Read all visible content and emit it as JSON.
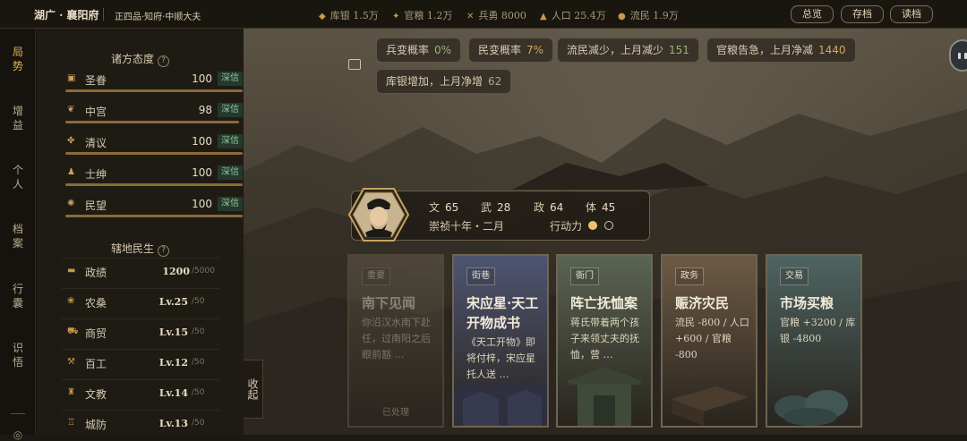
{
  "header": {
    "location": "湖广 · 襄阳府",
    "rank": "正四品·知府·中顺大夫",
    "resources": [
      {
        "icon": "silver-icon",
        "label": "库银",
        "value": "1.5万"
      },
      {
        "icon": "grain-icon",
        "label": "官粮",
        "value": "1.2万"
      },
      {
        "icon": "soldier-icon",
        "label": "兵勇",
        "value": "8000"
      },
      {
        "icon": "population-icon",
        "label": "人口",
        "value": "25.4万"
      },
      {
        "icon": "refugee-icon",
        "label": "流民",
        "value": "1.9万"
      }
    ],
    "buttons": {
      "overview": "总览",
      "save": "存档",
      "load": "读档"
    }
  },
  "nav": {
    "items": [
      "局势",
      "增益",
      "个人",
      "档案",
      "行囊",
      "识悟"
    ],
    "active": "局势"
  },
  "factions": {
    "title": "诸方态度",
    "help": "?",
    "rows": [
      {
        "icon": "emperor-icon",
        "name": "圣眷",
        "value": "100",
        "badge": "深信"
      },
      {
        "icon": "palace-icon",
        "name": "中宫",
        "value": "98",
        "badge": "深信"
      },
      {
        "icon": "scholar-icon",
        "name": "清议",
        "value": "100",
        "badge": "深信"
      },
      {
        "icon": "gentry-icon",
        "name": "士绅",
        "value": "100",
        "badge": "深信"
      },
      {
        "icon": "people-icon",
        "name": "民望",
        "value": "100",
        "badge": "深信"
      }
    ]
  },
  "territory": {
    "title": "辖地民生",
    "help": "?",
    "rows": [
      {
        "icon": "merit-icon",
        "name": "政绩",
        "value": "1200",
        "max": "/5000"
      },
      {
        "icon": "farm-icon",
        "name": "农桑",
        "value": "Lv.25",
        "max": "/50"
      },
      {
        "icon": "trade-icon",
        "name": "商贸",
        "value": "Lv.15",
        "max": "/50"
      },
      {
        "icon": "craft-icon",
        "name": "百工",
        "value": "Lv.12",
        "max": "/50"
      },
      {
        "icon": "education-icon",
        "name": "文教",
        "value": "Lv.14",
        "max": "/50"
      },
      {
        "icon": "defense-icon",
        "name": "城防",
        "value": "Lv.13",
        "max": "/50"
      }
    ]
  },
  "collapse_label": "收起",
  "notices": [
    {
      "label": "兵变概率",
      "value": "0%"
    },
    {
      "label": "民变概率",
      "value": "7%"
    },
    {
      "label": "流民减少，上月减少",
      "value": "151"
    },
    {
      "label": "官粮告急，上月净减",
      "value": "1440"
    },
    {
      "label": "库银增加，上月净增",
      "value": "62"
    }
  ],
  "character": {
    "stats": [
      {
        "label": "文",
        "value": "65"
      },
      {
        "label": "武",
        "value": "28"
      },
      {
        "label": "政",
        "value": "64"
      },
      {
        "label": "体",
        "value": "45"
      }
    ],
    "date": "崇祯十年・二月",
    "action_label": "行动力",
    "action_points": {
      "filled": 1,
      "total": 2
    }
  },
  "cards": [
    {
      "tag": "重要",
      "title": "南下见闻",
      "desc": "你沿汉水南下赴任，过南阳之后眼前豁 …",
      "status": "已处理",
      "color": "#6f6453"
    },
    {
      "tag": "街巷",
      "title": "宋应星·天工开物成书",
      "desc": "《天工开物》即将付梓，宋应星托人送 …",
      "status": "",
      "color": "#4e5570"
    },
    {
      "tag": "衙门",
      "title": "阵亡抚恤案",
      "desc": "蒋氏带着两个孩子来领丈夫的抚恤，营 …",
      "status": "",
      "color": "#5a6453"
    },
    {
      "tag": "政务",
      "title": "赈济灾民",
      "desc": "流民 -800 / 人口 +600 / 官粮 -800",
      "status": "",
      "color": "#6d5a44"
    },
    {
      "tag": "交易",
      "title": "市场买粮",
      "desc": "官粮 +3200 / 库银 -4800",
      "status": "",
      "color": "#4e6462"
    }
  ]
}
